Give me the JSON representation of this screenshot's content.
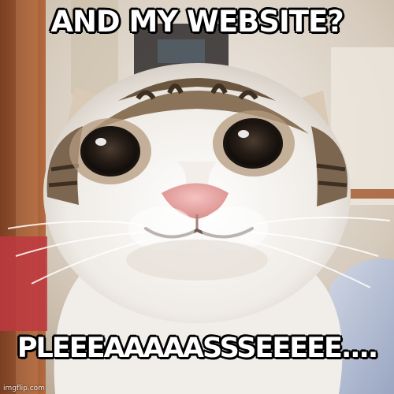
{
  "meme": {
    "top_text": "AND MY WEBSITE?",
    "bottom_text": "PLEEEAAAAASSSEEEEE....",
    "watermark": "imgflip.com",
    "subject": "smiling-tabby-white-cat"
  },
  "colors": {
    "caption_fill": "#ffffff",
    "caption_outline": "#000000",
    "fur_white": "#f4f1ee",
    "fur_tabby": "#8a7358",
    "nose_pink": "#e7a6a4",
    "eye_dark": "#2a2420",
    "background_wall": "#d9d1c6",
    "background_door": "#a9633c"
  }
}
